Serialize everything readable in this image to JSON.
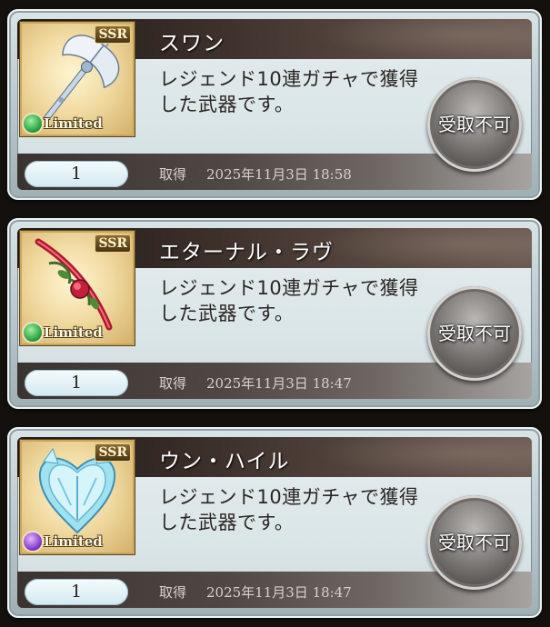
{
  "items": [
    {
      "name": "スワン",
      "description": "レジェンド10連ガチャで獲得した武器です。",
      "quantity": "1",
      "acquired_label": "取得",
      "acquired_at": "2025年11月3日 18:58",
      "button_label": "受取不可",
      "rarity": "SSR",
      "limited_label": "Limited",
      "element": "wind",
      "element_icon": "wind-element-icon",
      "weapon_icon": "swan-axe-icon"
    },
    {
      "name": "エターナル・ラヴ",
      "description": "レジェンド10連ガチャで獲得した武器です。",
      "quantity": "1",
      "acquired_label": "取得",
      "acquired_at": "2025年11月3日 18:47",
      "button_label": "受取不可",
      "rarity": "SSR",
      "limited_label": "Limited",
      "element": "wind",
      "element_icon": "wind-element-icon",
      "weapon_icon": "eternal-love-sword-icon"
    },
    {
      "name": "ウン・ハイル",
      "description": "レジェンド10連ガチャで獲得した武器です。",
      "quantity": "1",
      "acquired_label": "取得",
      "acquired_at": "2025年11月3日 18:47",
      "button_label": "受取不可",
      "rarity": "SSR",
      "limited_label": "Limited",
      "element": "dark",
      "element_icon": "dark-element-icon",
      "weapon_icon": "unheil-crystal-icon"
    }
  ]
}
